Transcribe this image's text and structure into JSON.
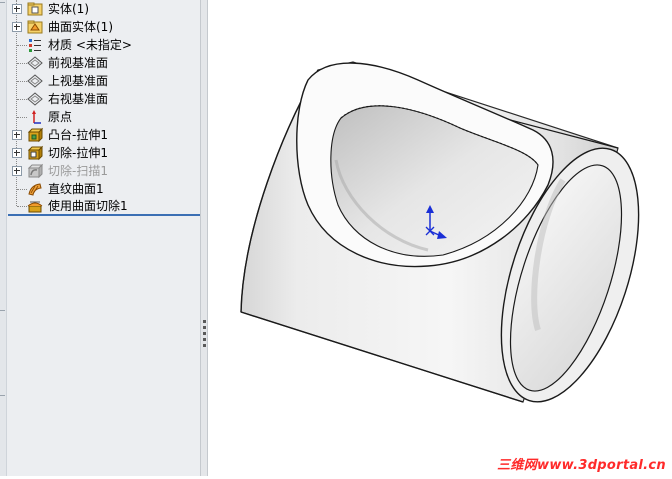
{
  "feature_tree": {
    "items": [
      {
        "label": "实体(1)",
        "expandable": true,
        "icon": "solid-body-folder-icon"
      },
      {
        "label": "曲面实体(1)",
        "expandable": true,
        "icon": "surface-body-folder-icon"
      },
      {
        "label": "材质 <未指定>",
        "expandable": false,
        "icon": "material-icon"
      },
      {
        "label": "前视基准面",
        "expandable": false,
        "icon": "plane-icon"
      },
      {
        "label": "上视基准面",
        "expandable": false,
        "icon": "plane-icon"
      },
      {
        "label": "右视基准面",
        "expandable": false,
        "icon": "plane-icon"
      },
      {
        "label": "原点",
        "expandable": false,
        "icon": "origin-icon"
      },
      {
        "label": "凸台-拉伸1",
        "expandable": true,
        "icon": "boss-extrude-icon"
      },
      {
        "label": "切除-拉伸1",
        "expandable": true,
        "icon": "cut-extrude-icon"
      },
      {
        "label": "切除-扫描1",
        "expandable": true,
        "icon": "cut-sweep-icon",
        "suppressed": true
      },
      {
        "label": "直纹曲面1",
        "expandable": false,
        "icon": "ruled-surface-icon"
      },
      {
        "label": "使用曲面切除1",
        "expandable": false,
        "icon": "surface-cut-icon"
      }
    ]
  },
  "viewport": {
    "model": "hollow-cylinder-with-saddle-cutout",
    "triad_icon": "coordinate-triad-icon"
  },
  "watermark": "三维网www.3dportal.cn",
  "colors": {
    "panel_bg": "#eceef1",
    "selection_rule": "#3b6fb4",
    "triad_blue": "#1a2fd6",
    "watermark": "#ff2a2a"
  }
}
